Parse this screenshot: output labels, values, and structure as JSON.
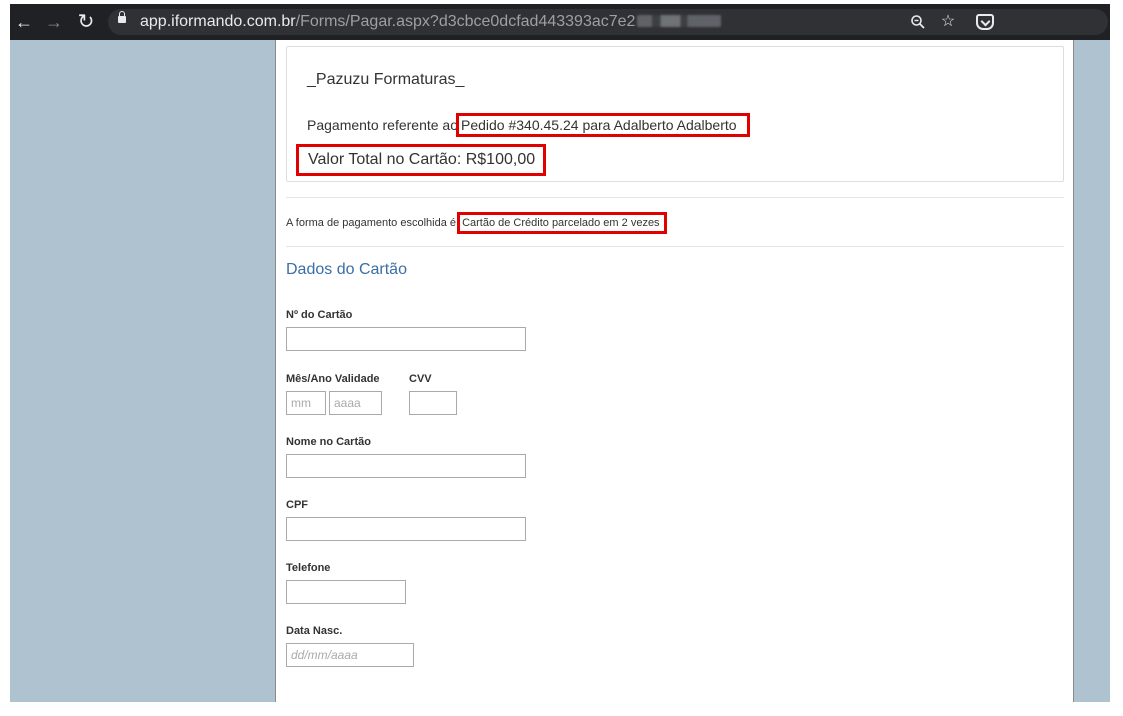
{
  "browser": {
    "url_host": "app.iformando.com.br",
    "url_path": "/Forms/Pagar.aspx?d3cbce0dcfad443393ac7e2"
  },
  "header": {
    "company": "_Pazuzu Formaturas_",
    "ref_prefix": "Pagamento referente ao",
    "ref_order": "Pedido #340.45.24 para Adalberto Adalberto",
    "total": "Valor Total no Cartão: R$100,00"
  },
  "payment": {
    "prefix": "A forma de pagamento escolhida é:",
    "method": "Cartão de Crédito parcelado em 2 vezes"
  },
  "form": {
    "section_title": "Dados do Cartão",
    "card_number_label": "Nº do Cartão",
    "expiry_label": "Mês/Ano Validade",
    "month_placeholder": "mm",
    "year_placeholder": "aaaa",
    "cvv_label": "CVV",
    "name_label": "Nome no Cartão",
    "cpf_label": "CPF",
    "phone_label": "Telefone",
    "birth_label": "Data Nasc.",
    "birth_placeholder": "dd/mm/aaaa"
  },
  "colors": {
    "page_bg": "#aec3cf",
    "highlight": "#e00000",
    "section_title": "#3a6ea5",
    "chrome": "#202124"
  },
  "icons": [
    "back-arrow-icon",
    "forward-arrow-icon",
    "reload-icon",
    "lock-icon",
    "zoom-icon",
    "star-icon",
    "pocket-icon"
  ]
}
